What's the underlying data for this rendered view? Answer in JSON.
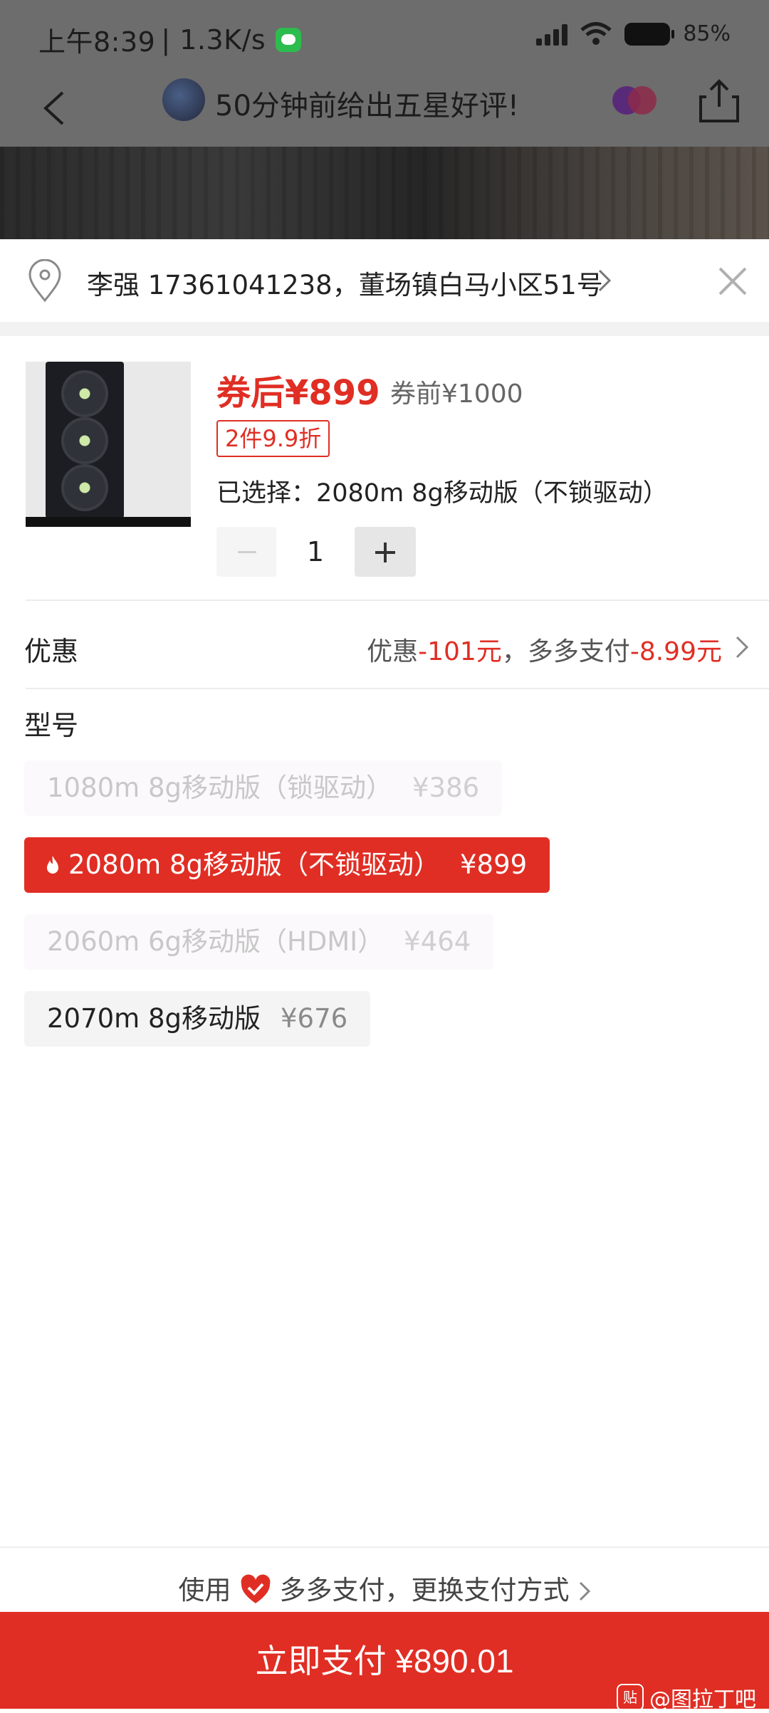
{
  "status_bar": {
    "time": "上午8:39",
    "network_speed": "| 1.3K/s",
    "battery": "85%"
  },
  "nav": {
    "title": "50分钟前给出五星好评!",
    "back_icon": "chevron-left-icon",
    "share_icon": "share-icon"
  },
  "address": {
    "text": "李强 17361041238，董场镇白马小区51号",
    "pin_icon": "location-pin-icon",
    "close_icon": "close-icon"
  },
  "product": {
    "price_after_coupon": "券后¥899",
    "price_before_coupon": "券前¥1000",
    "discount_tag": "2件9.9折",
    "selected": "已选择：2080m 8g移动版（不锁驱动）",
    "quantity": "1"
  },
  "promotion": {
    "label": "优惠",
    "prefix": "优惠",
    "discount": "-101元",
    "middle": "，多多支付",
    "pay_discount": "-8.99元"
  },
  "models": {
    "label": "型号",
    "options": [
      {
        "name": "1080m 8g移动版（锁驱动）",
        "price": "¥386",
        "state": "disabled"
      },
      {
        "name": "2080m 8g移动版（不锁驱动）",
        "price": "¥899",
        "state": "selected"
      },
      {
        "name": "2060m 6g移动版（HDMI）",
        "price": "¥464",
        "state": "disabled"
      },
      {
        "name": "2070m 8g移动版",
        "price": "¥676",
        "state": "normal"
      }
    ]
  },
  "payment": {
    "use": "使用",
    "method": "多多支付，更换支付方式",
    "pay_button": "立即支付 ¥890.01"
  },
  "watermark": "@图拉丁吧",
  "colors": {
    "accent": "#e02e24",
    "overlay": "#6d6d6d"
  }
}
